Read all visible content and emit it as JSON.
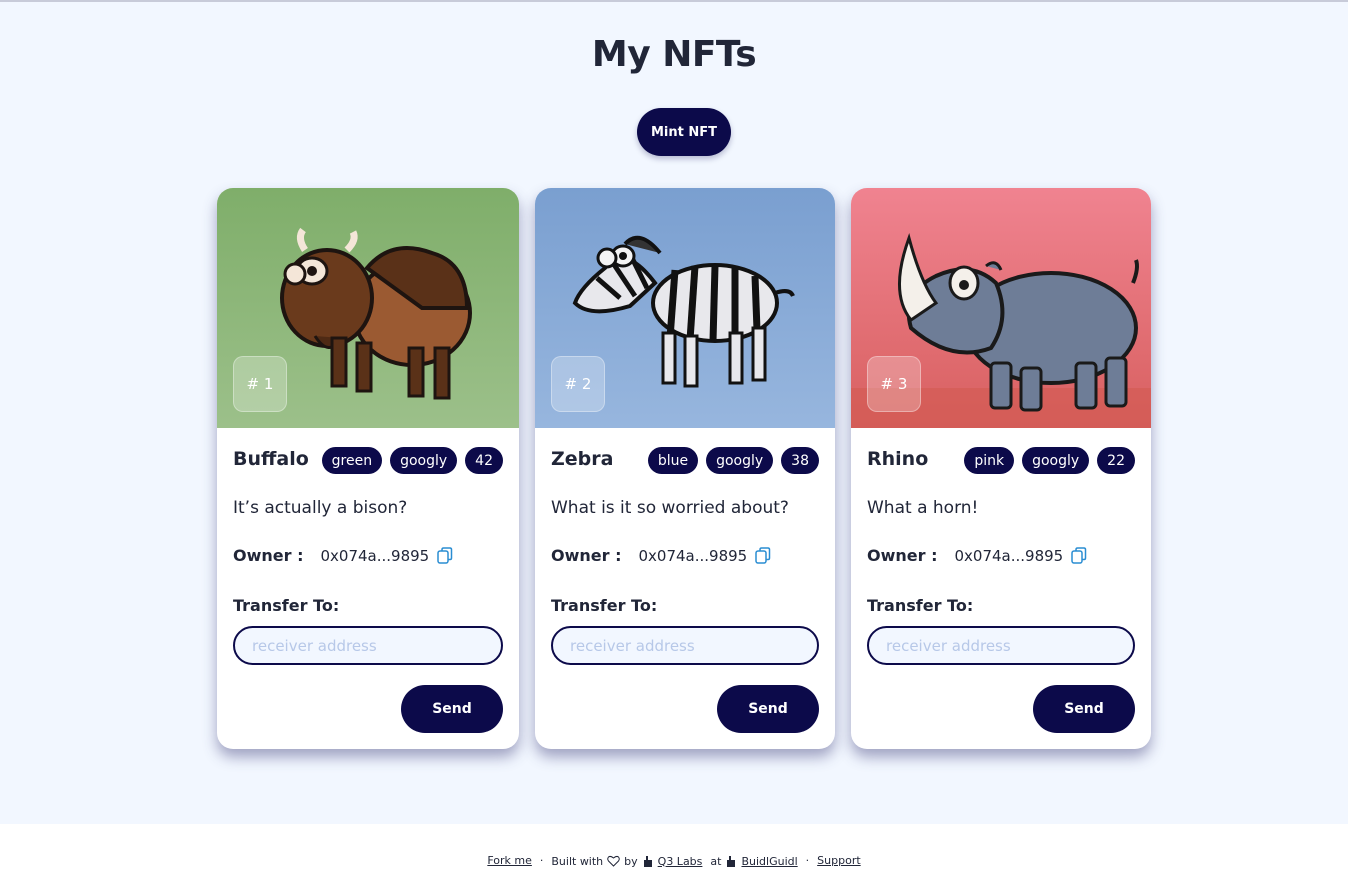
{
  "page": {
    "title": "My NFTs"
  },
  "actions": {
    "mint_label": "Mint NFT"
  },
  "cards": [
    {
      "id_label": "# 1",
      "name": "Buffalo",
      "tags": [
        "green",
        "googly",
        "42"
      ],
      "description": "It’s actually a bison?",
      "owner_label": "Owner :",
      "owner_address": "0x074a...9895",
      "transfer_label": "Transfer To:",
      "input_placeholder": "receiver address",
      "send_label": "Send",
      "image": {
        "animal": "buffalo-icon",
        "bg_top": "#7fae6a",
        "bg_bottom": "#9cc08a"
      }
    },
    {
      "id_label": "# 2",
      "name": "Zebra",
      "tags": [
        "blue",
        "googly",
        "38"
      ],
      "description": "What is it so worried about?",
      "owner_label": "Owner :",
      "owner_address": "0x074a...9895",
      "transfer_label": "Transfer To:",
      "input_placeholder": "receiver address",
      "send_label": "Send",
      "image": {
        "animal": "zebra-icon",
        "bg_top": "#7a9fd0",
        "bg_bottom": "#97b6de"
      }
    },
    {
      "id_label": "# 3",
      "name": "Rhino",
      "tags": [
        "pink",
        "googly",
        "22"
      ],
      "description": "What a horn!",
      "owner_label": "Owner :",
      "owner_address": "0x074a...9895",
      "transfer_label": "Transfer To:",
      "input_placeholder": "receiver address",
      "send_label": "Send",
      "image": {
        "animal": "rhino-icon",
        "bg_top": "#f08390",
        "bg_bottom": "#d86060"
      }
    }
  ],
  "footer": {
    "fork_label": "Fork me",
    "built_with": "Built with",
    "by": "by",
    "org": "Q3 Labs",
    "at": "at",
    "guild": "BuidlGuidl",
    "support": "Support"
  },
  "colors": {
    "accent": "#0c0a4a",
    "background": "#f2f7ff",
    "card": "#ffffff",
    "copy_icon": "#2a8dd2"
  }
}
